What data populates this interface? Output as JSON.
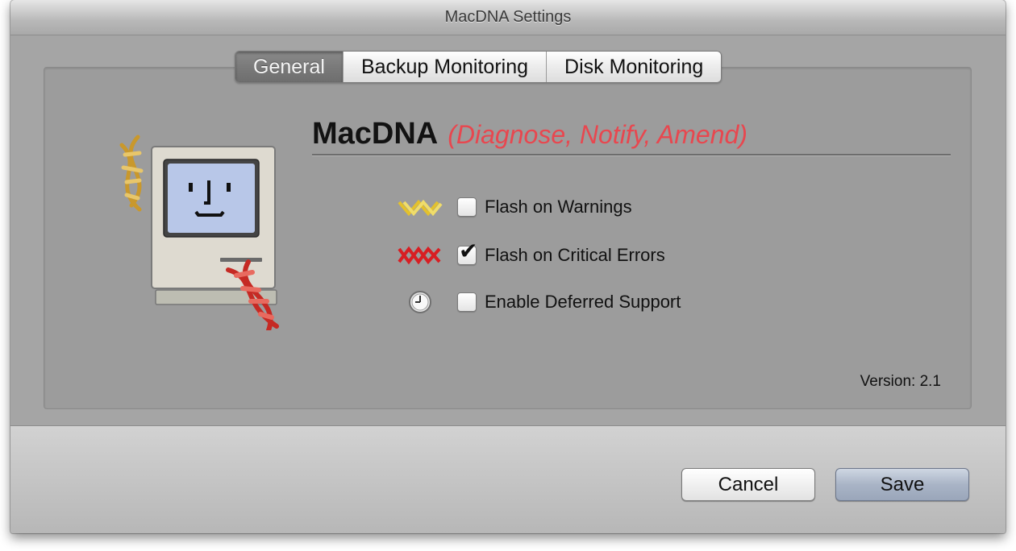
{
  "window": {
    "title": "MacDNA Settings"
  },
  "tabs": [
    {
      "label": "General",
      "selected": true
    },
    {
      "label": "Backup Monitoring",
      "selected": false
    },
    {
      "label": "Disk Monitoring",
      "selected": false
    }
  ],
  "general": {
    "app_name": "MacDNA",
    "tagline": "(Diagnose, Notify, Amend)",
    "options": [
      {
        "label": "Flash on Warnings",
        "checked": false,
        "icon": "yellow-dna-warning-icon"
      },
      {
        "label": "Flash on Critical Errors",
        "checked": true,
        "icon": "red-dna-error-icon"
      },
      {
        "label": "Enable Deferred Support",
        "checked": false,
        "icon": "clock-icon"
      }
    ],
    "version": "Version: 2.1",
    "illustration_icon": "mac-dna-logo-icon"
  },
  "buttons": {
    "cancel_label": "Cancel",
    "save_label": "Save"
  },
  "colors": {
    "tagline": "#e8474f",
    "warning_icon": "#e3c12c",
    "error_icon": "#d81e23"
  }
}
